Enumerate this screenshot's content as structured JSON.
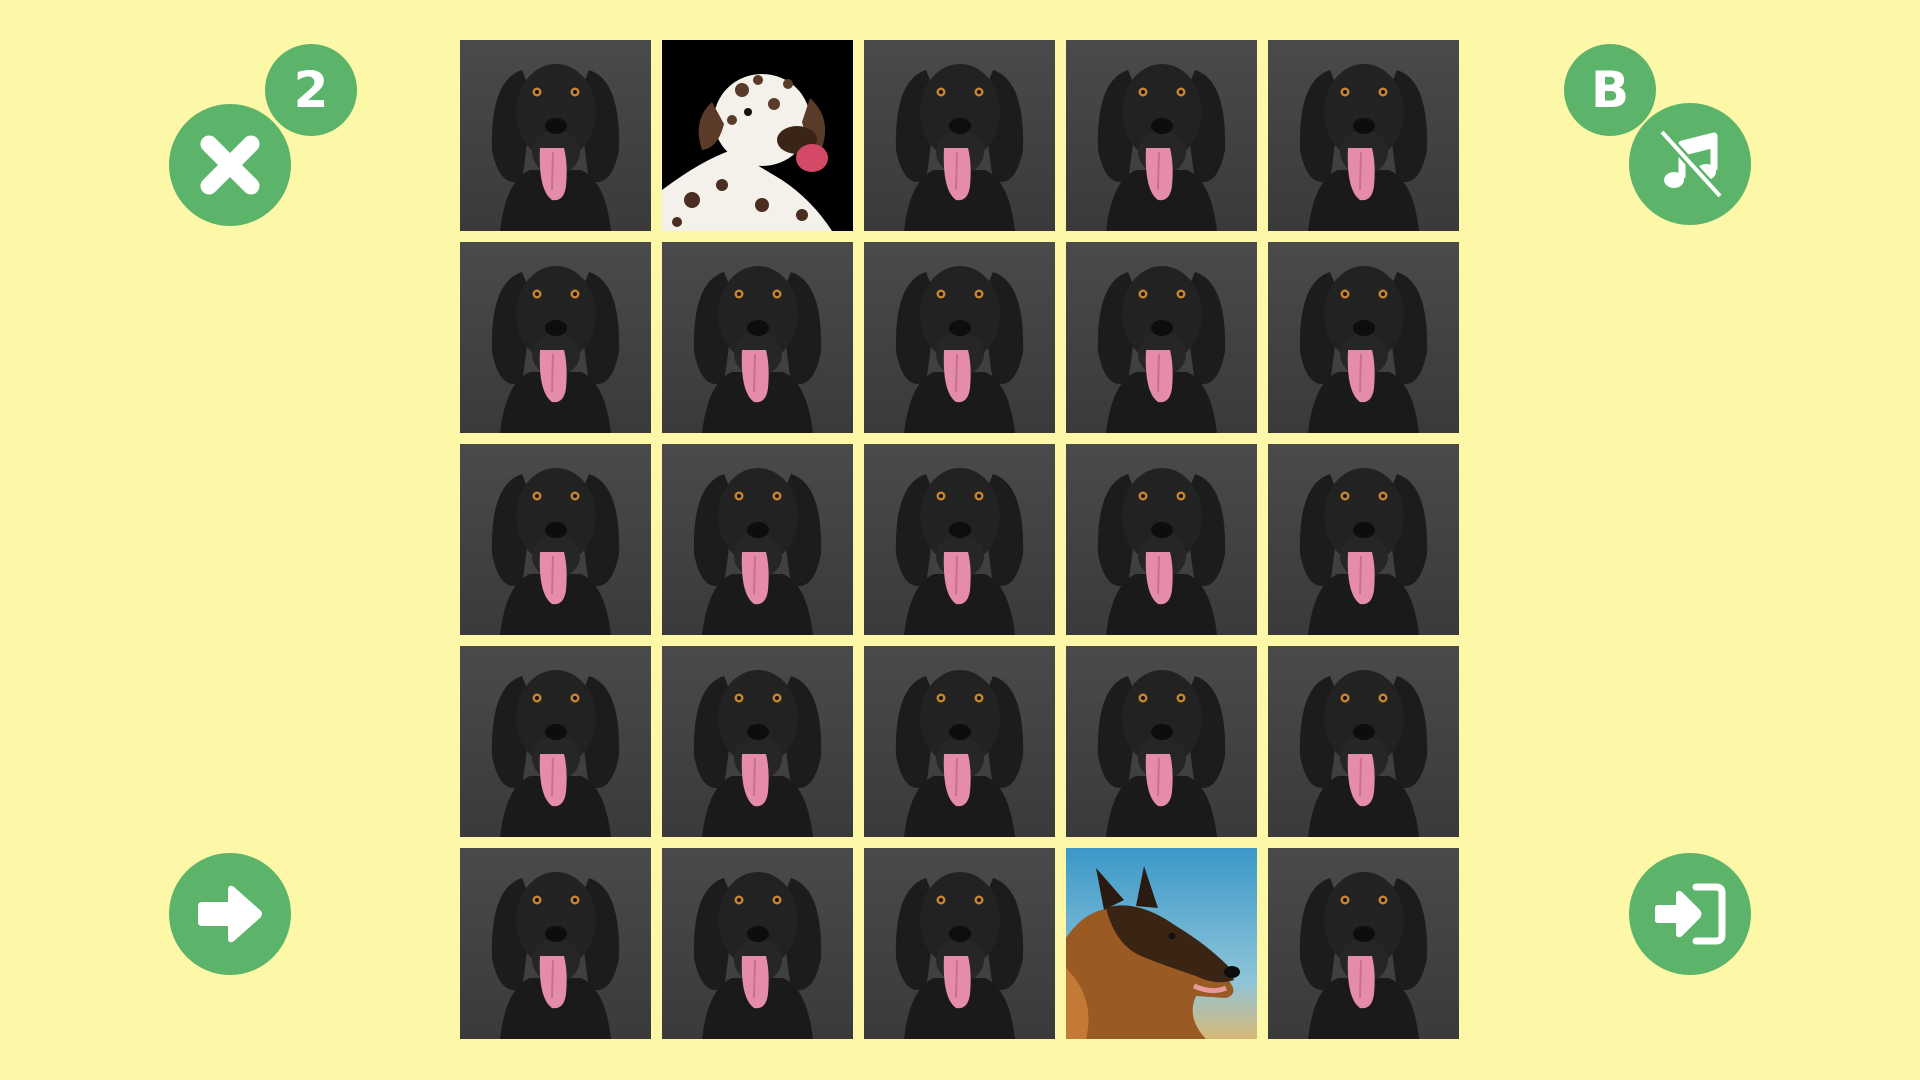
{
  "hud": {
    "mistakes": "2",
    "level": "B",
    "colors": {
      "background": "#fdf8a8",
      "button": "#5cb46a",
      "button_icon": "#ffffff"
    },
    "icons": {
      "close": "close-x-icon",
      "next": "arrow-right-icon",
      "music": "music-muted-icon",
      "exit": "sign-in-icon"
    }
  },
  "board": {
    "rows": 5,
    "cols": 5,
    "card_back": "black-dog-card-back",
    "cards": [
      "back",
      "dalmatian",
      "back",
      "back",
      "back",
      "back",
      "back",
      "back",
      "back",
      "back",
      "back",
      "back",
      "back",
      "back",
      "back",
      "back",
      "back",
      "back",
      "back",
      "back",
      "back",
      "back",
      "back",
      "german-shepherd",
      "back"
    ]
  }
}
